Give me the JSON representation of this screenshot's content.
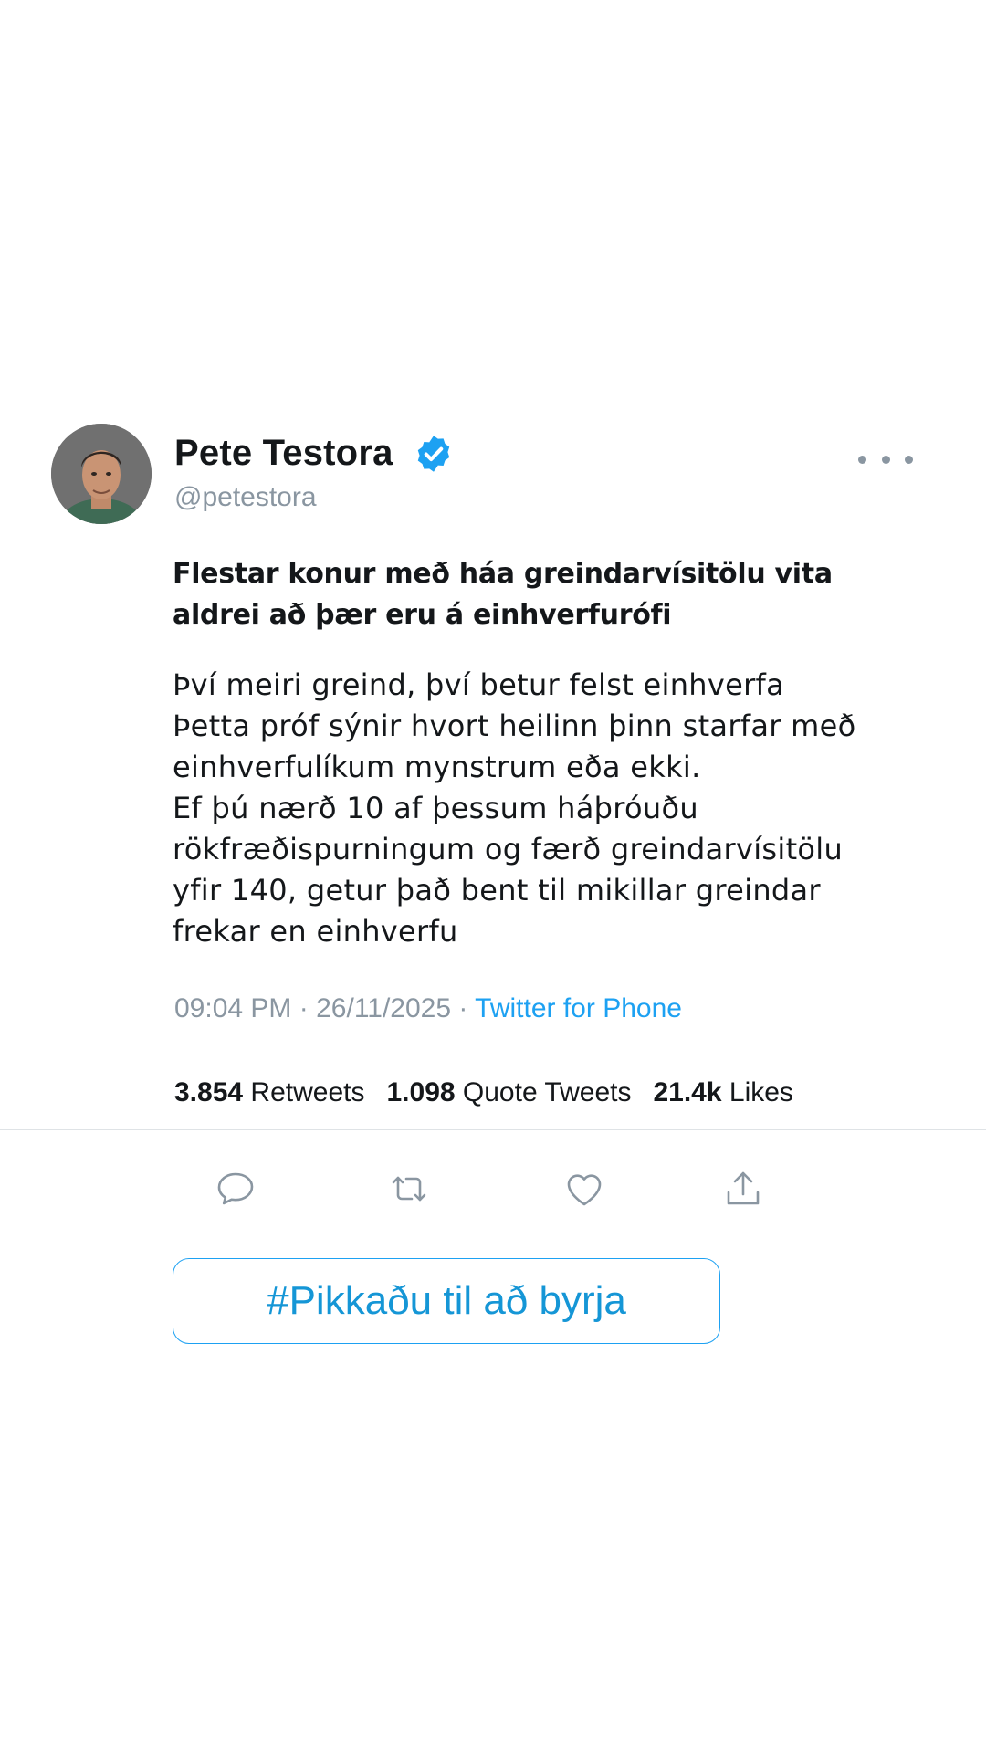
{
  "user": {
    "display_name": "Pete Testora",
    "handle": "@petestora",
    "verified": true
  },
  "tweet": {
    "headline": "Flestar konur með háa greindarvísitölu vita aldrei að þær eru á einhverfurófi",
    "body": "Því meiri greind, því betur felst einhverfa\nÞetta próf sýnir hvort heilinn þinn starfar með einhverfulíkum mynstrum eða ekki.\nEf þú nærð 10 af þessum háþróuðu rökfræðispurningum og færð greindarvísitölu yfir 140, getur það bent til mikillar greindar frekar en einhverfu",
    "time": "09:04 PM",
    "date": "26/11/2025",
    "separator": "·",
    "source": "Twitter for Phone"
  },
  "stats": {
    "retweets_count": "3.854",
    "retweets_label": "Retweets",
    "quotes_count": "1.098",
    "quotes_label": "Quote Tweets",
    "likes_count": "21.4k",
    "likes_label": "Likes"
  },
  "cta": {
    "label": "#Pikkaðu til að byrja"
  },
  "colors": {
    "accent": "#1da1f2",
    "muted": "#8a96a1",
    "text": "#14171a"
  },
  "icons": [
    "verified-badge-icon",
    "more-options-icon",
    "reply-icon",
    "retweet-icon",
    "like-icon",
    "share-icon"
  ]
}
